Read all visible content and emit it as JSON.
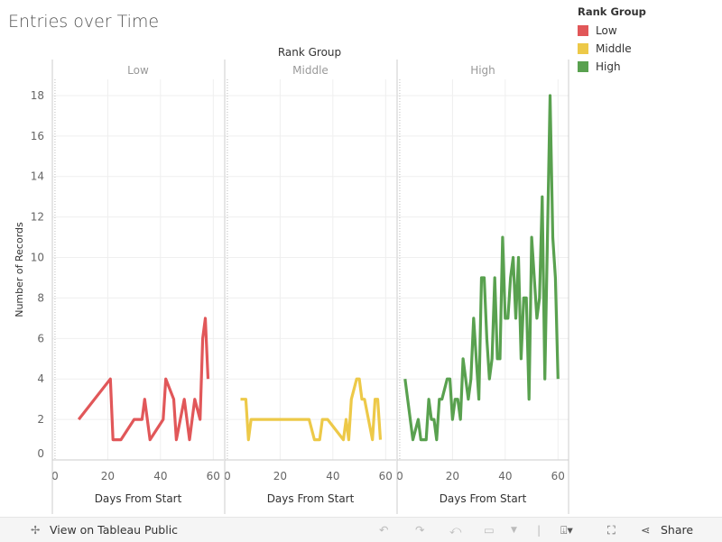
{
  "title": "Entries over Time",
  "legend": {
    "title": "Rank Group",
    "items": [
      {
        "label": "Low",
        "color": "#e15759"
      },
      {
        "label": "Middle",
        "color": "#edc948"
      },
      {
        "label": "High",
        "color": "#59a14f"
      }
    ]
  },
  "toolbar": {
    "view": "View on Tableau Public",
    "share": "Share"
  },
  "chart_data": {
    "type": "line",
    "title": "Entries over Time",
    "column_header": "Rank Group",
    "xlabel": "Days From Start",
    "ylabel": "Number of Records",
    "xlim": [
      -1,
      64
    ],
    "ylim": [
      0,
      18.8
    ],
    "xticks": [
      0,
      20,
      40,
      60
    ],
    "yticks": [
      0,
      2,
      4,
      6,
      8,
      10,
      12,
      14,
      16,
      18
    ],
    "grid": true,
    "legend_position": "top-right",
    "series": [
      {
        "name": "Low",
        "color": "#e15759",
        "x": [
          9,
          21,
          22,
          25,
          30,
          33,
          34,
          36,
          41,
          42,
          45,
          46,
          49,
          51,
          53,
          55,
          56,
          57,
          58
        ],
        "y": [
          2,
          4,
          1,
          1,
          2,
          2,
          3,
          1,
          2,
          4,
          3,
          1,
          3,
          1,
          3,
          2,
          6,
          7,
          4
        ]
      },
      {
        "name": "Middle",
        "color": "#edc948",
        "x": [
          5,
          7,
          8,
          9,
          31,
          33,
          35,
          36,
          38,
          44,
          45,
          46,
          47,
          49,
          50,
          51,
          52,
          55,
          56,
          57,
          58
        ],
        "y": [
          3,
          3,
          1,
          2,
          2,
          1,
          1,
          2,
          2,
          1,
          2,
          1,
          3,
          4,
          4,
          3,
          3,
          1,
          3,
          3,
          1
        ]
      },
      {
        "name": "High",
        "color": "#59a14f",
        "x": [
          2,
          5,
          7,
          8,
          10,
          11,
          12,
          13,
          14,
          15,
          16,
          18,
          19,
          20,
          21,
          22,
          23,
          24,
          26,
          27,
          28,
          30,
          31,
          32,
          33,
          34,
          35,
          36,
          37,
          38,
          39,
          40,
          41,
          42,
          43,
          44,
          45,
          46,
          47,
          48,
          49,
          50,
          51,
          52,
          53,
          54,
          55,
          57,
          58,
          59,
          60
        ],
        "y": [
          4,
          1,
          2,
          1,
          1,
          3,
          2,
          2,
          1,
          3,
          3,
          4,
          4,
          2,
          3,
          3,
          2,
          5,
          3,
          4,
          7,
          3,
          9,
          9,
          6,
          4,
          5,
          9,
          5,
          5,
          11,
          7,
          7,
          9,
          10,
          7,
          10,
          5,
          8,
          8,
          3,
          11,
          9,
          7,
          8,
          13,
          4,
          18,
          11,
          9,
          4
        ]
      }
    ]
  }
}
